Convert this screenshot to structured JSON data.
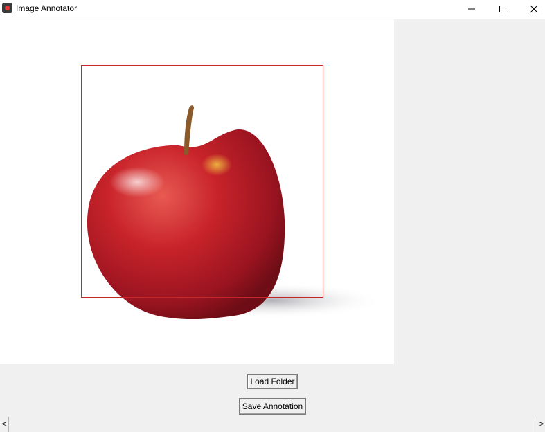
{
  "window": {
    "title": "Image Annotator",
    "icon": "app-icon",
    "controls": [
      "minimize-icon",
      "maximize-icon",
      "close-icon"
    ]
  },
  "canvas": {
    "image_subject": "red-apple",
    "annotation_box_color": "#c62828"
  },
  "buttons": {
    "load_folder": "Load Folder",
    "save_annotation": "Save Annotation"
  },
  "scrollbar": {
    "left_arrow": "<",
    "right_arrow": ">"
  },
  "colors": {
    "window_bg": "#f0f0f0",
    "canvas_bg": "#ffffff",
    "bbox": "#c62828"
  }
}
